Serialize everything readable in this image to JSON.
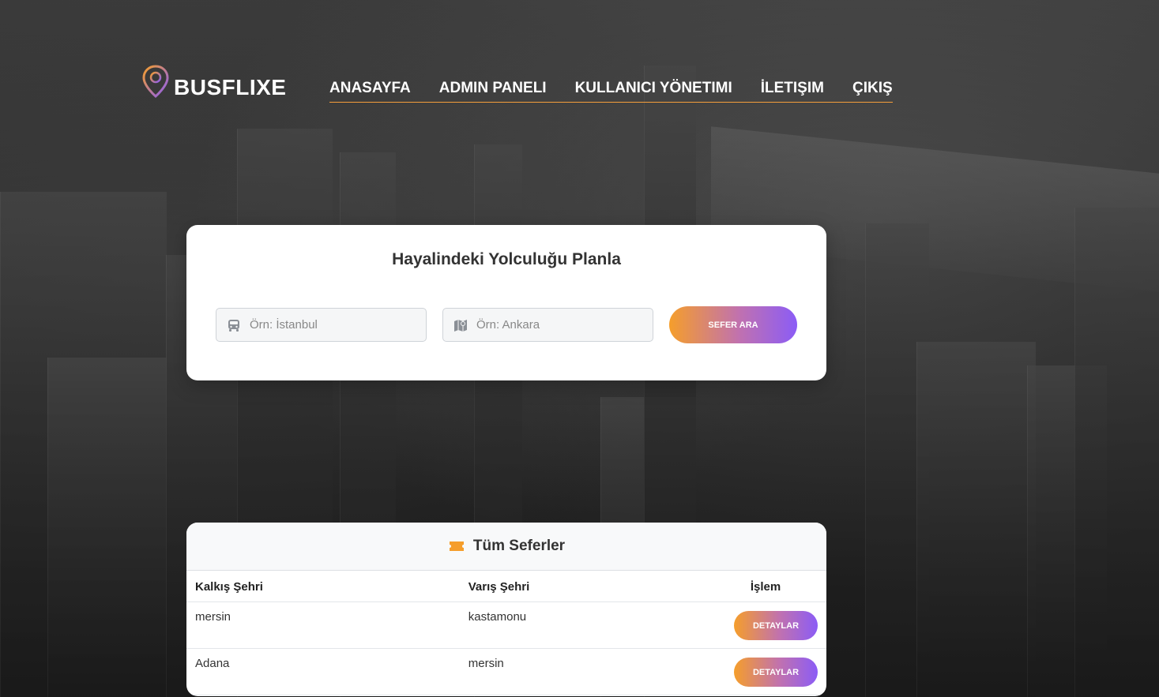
{
  "brand": {
    "name": "BUSFLIXE",
    "icon": "map-pin-icon"
  },
  "nav": {
    "items": [
      {
        "label": "ANASAYFA"
      },
      {
        "label": "ADMIN PANELI"
      },
      {
        "label": "KULLANICI YÖNETIMI"
      },
      {
        "label": "İLETIŞIM"
      },
      {
        "label": "ÇIKIŞ"
      }
    ]
  },
  "search": {
    "title": "Hayalindeki Yolculuğu Planla",
    "from_placeholder": "Örn: İstanbul",
    "from_icon": "bus-icon",
    "to_placeholder": "Örn: Ankara",
    "to_icon": "map-icon",
    "button_label": "SEFER ARA"
  },
  "trips": {
    "title": "Tüm Seferler",
    "icon": "ticket-icon",
    "columns": [
      "Kalkış Şehri",
      "Varış Şehri",
      "İşlem"
    ],
    "rows": [
      {
        "from": "mersin",
        "to": "kastamonu",
        "action": "DETAYLAR"
      },
      {
        "from": "Adana",
        "to": "mersin",
        "action": "DETAYLAR"
      }
    ]
  },
  "colors": {
    "accent_orange": "#f59e2b",
    "accent_purple": "#8b5cf6",
    "nav_underline": "#f59e3b"
  }
}
